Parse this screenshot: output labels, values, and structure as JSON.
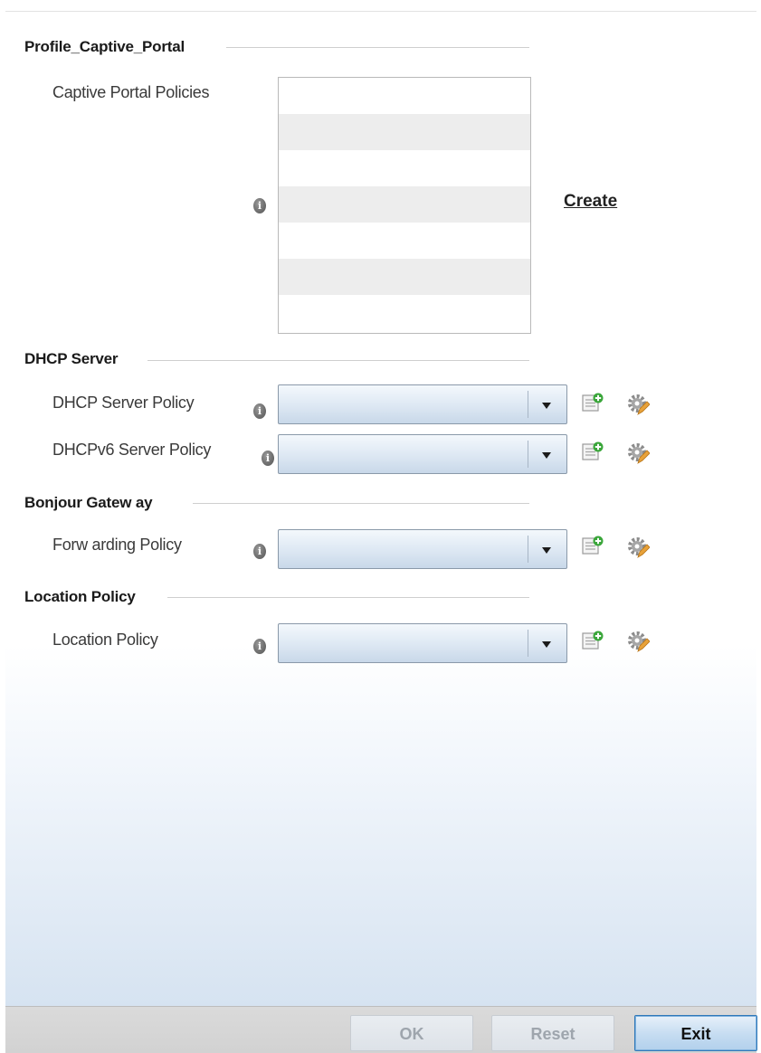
{
  "sections": {
    "captive_portal": {
      "title": "Profile_Captive_Portal",
      "policies_label": "Captive Portal Policies",
      "create_link": "Create"
    },
    "dhcp": {
      "title": "DHCP Server",
      "server_policy_label": "DHCP Server Policy",
      "server_policy_value": "",
      "v6_policy_label": "DHCPv6 Server Policy",
      "v6_policy_value": ""
    },
    "bonjour": {
      "title": "Bonjour Gatew ay",
      "forwarding_label": "Forw arding Policy",
      "forwarding_value": ""
    },
    "location": {
      "title": "Location Policy",
      "policy_label": "Location Policy",
      "policy_value": ""
    }
  },
  "footer": {
    "ok_label": "OK",
    "reset_label": "Reset",
    "exit_label": "Exit"
  },
  "icons": {
    "info": "info-icon",
    "add": "add-policy-icon",
    "edit": "edit-gear-icon",
    "dropdown": "chevron-down-icon"
  },
  "colors": {
    "select_gradient_top": "#f4f8fc",
    "select_gradient_bottom": "#c8d8e9",
    "exit_border": "#2f78b8",
    "add_badge": "#3aa63a"
  }
}
